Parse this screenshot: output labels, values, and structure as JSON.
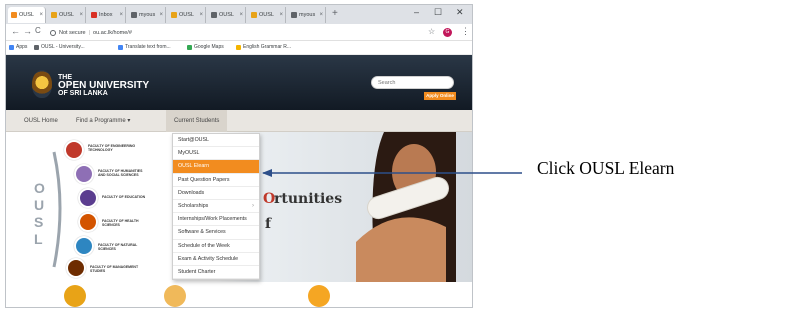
{
  "browser": {
    "tabs": [
      {
        "label": "OUSL",
        "favicon_color": "#f28c1f",
        "active": true
      },
      {
        "label": "OUSL",
        "favicon_color": "#e8a317",
        "active": false
      },
      {
        "label": "Inbox",
        "favicon_color": "#d93025",
        "active": false
      },
      {
        "label": "myous",
        "favicon_color": "#5f6368",
        "active": false
      },
      {
        "label": "OUSL",
        "favicon_color": "#e8a317",
        "active": false
      },
      {
        "label": "OUSL",
        "favicon_color": "#5f6368",
        "active": false
      },
      {
        "label": "OUSL",
        "favicon_color": "#e8a317",
        "active": false
      },
      {
        "label": "myous",
        "favicon_color": "#5f6368",
        "active": false
      }
    ],
    "tab_close": "×",
    "new_tab": "+",
    "window_controls": {
      "minimize": "–",
      "maximize": "☐",
      "close": "✕"
    },
    "nav": {
      "back": "←",
      "forward": "→",
      "reload": "C"
    },
    "url_security": "Not secure",
    "url": "ou.ac.lk/home/#",
    "star": "☆",
    "profile_initial": "G",
    "menu": "⋮",
    "bookmarks": [
      {
        "label": "Apps",
        "icon_color": "#4285f4"
      },
      {
        "label": "OUSL - University...",
        "icon_color": "#5f6368"
      },
      {
        "label": "Translate text from...",
        "icon_color": "#4285f4"
      },
      {
        "label": "Google Maps",
        "icon_color": "#34a853"
      },
      {
        "label": "English Grammar R...",
        "icon_color": "#f4b400"
      }
    ]
  },
  "site": {
    "logo": {
      "line1": "THE",
      "line2": "OPEN UNIVERSITY",
      "line3": "OF SRI LANKA"
    },
    "search_placeholder": "Search",
    "apply_button": "Apply Online",
    "nav": [
      {
        "label": "OUSL Home"
      },
      {
        "label": "Find a Programme  ▾"
      },
      {
        "label": "Current Students"
      }
    ],
    "dropdown": [
      {
        "label": "Start@OUSL",
        "highlighted": false
      },
      {
        "label": "MyOUSL",
        "highlighted": false
      },
      {
        "label": "OUSL Elearn",
        "highlighted": true
      },
      {
        "label": "Past Question Papers",
        "highlighted": false
      },
      {
        "label": "Downloads",
        "highlighted": false
      },
      {
        "label": "Scholarships",
        "highlighted": false,
        "submenu": "›"
      },
      {
        "label": "Internships/Work Placements",
        "highlighted": false
      },
      {
        "label": "Software & Services",
        "highlighted": false
      },
      {
        "label": "Schedule of the Week",
        "highlighted": false
      },
      {
        "label": "Exam & Activity Schedule",
        "highlighted": false
      },
      {
        "label": "Student Charter",
        "highlighted": false
      }
    ],
    "hero": {
      "ousl_letters": [
        "O",
        "U",
        "S",
        "L"
      ],
      "headline_fragment": "rtunities",
      "fragment_o": "O",
      "fragment_f": "f",
      "faculties": [
        {
          "label": "FACULTY OF ENGINEERING TECHNOLOGY",
          "color": "#c0392b"
        },
        {
          "label": "FACULTY OF HUMANITIES AND SOCIAL SCIENCES",
          "color": "#8e6fb5"
        },
        {
          "label": "FACULTY OF EDUCATION",
          "color": "#5b3d8f"
        },
        {
          "label": "FACULTY OF HEALTH SCIENCES",
          "color": "#d35400"
        },
        {
          "label": "FACULTY OF NATURAL SCIENCES",
          "color": "#2e86c1"
        },
        {
          "label": "FACULTY OF MANAGEMENT STUDIES",
          "color": "#6e2c00"
        }
      ]
    },
    "bottom_icon_colors": [
      "#e8a317",
      "#f0b95a",
      "#f5a623"
    ]
  },
  "annotation": {
    "text": "Click OUSL Elearn"
  }
}
